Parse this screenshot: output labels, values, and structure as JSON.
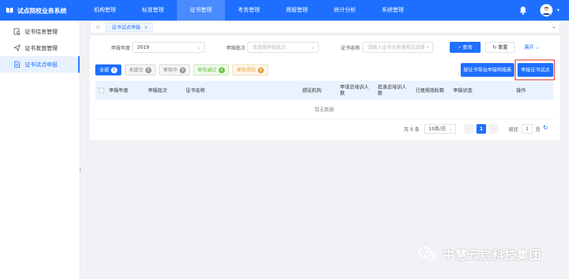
{
  "app": {
    "title": "试点院校业务系统"
  },
  "nav": [
    "机构管理",
    "标准管理",
    "证书管理",
    "考务管理",
    "周报管理",
    "统计分析",
    "系统管理"
  ],
  "sidebar": {
    "items": [
      {
        "label": "证书信息管理",
        "icon": "search-doc-icon"
      },
      {
        "label": "证书发放管理",
        "icon": "send-icon"
      },
      {
        "label": "证书试点申报",
        "icon": "document-icon"
      }
    ]
  },
  "tabs": [
    {
      "label": "证书试点申报"
    }
  ],
  "filters": {
    "year_label": "申报年度",
    "year_value": "2019",
    "batch_label": "申报批次",
    "batch_placeholder": "请选择申报批次",
    "name_label": "证书名称",
    "name_placeholder": "请输入证书名称搜索后选择"
  },
  "buttons": {
    "search": "查询",
    "reset": "重置",
    "expand": "展开",
    "export": "按证书导出申报明细表",
    "apply": "申报证书试点"
  },
  "status_tabs": [
    {
      "label": "全部",
      "count": "0"
    },
    {
      "label": "未提交",
      "count": "0"
    },
    {
      "label": "审核中",
      "count": "0"
    },
    {
      "label": "审核通过",
      "count": "0"
    },
    {
      "label": "审核退回",
      "count": "0"
    }
  ],
  "table": {
    "columns": [
      "申报年度",
      "申报批次",
      "证书名称",
      "颁证机构",
      "申请总培训人数",
      "批准总培训人数",
      "已使用指标数",
      "申报状态",
      "操作"
    ],
    "empty_text": "暂无数据"
  },
  "pagination": {
    "total": "共 0 条",
    "page_size": "10条/页",
    "current_page": "1",
    "goto_label": "前往",
    "goto_value": "1",
    "page_suffix": "页"
  },
  "watermark": {
    "text": "中慧云启科技集团"
  },
  "colors": {
    "primary": "#1e6fff",
    "highlight": "#e02020"
  }
}
